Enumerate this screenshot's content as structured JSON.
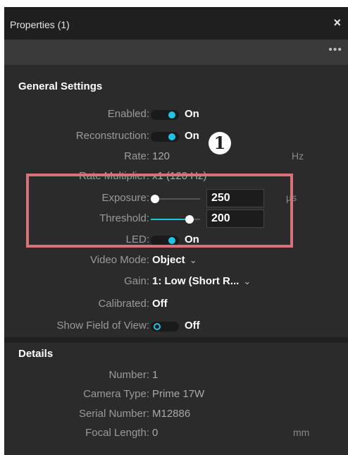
{
  "window": {
    "title": "Properties (1)",
    "close_glyph": "×",
    "more_glyph": "•••"
  },
  "general": {
    "title": "General Settings",
    "enabled": {
      "label": "Enabled:",
      "state": "On"
    },
    "reconstruction": {
      "label": "Reconstruction:",
      "state": "On"
    },
    "rate": {
      "label": "Rate:",
      "value": "120",
      "unit": "Hz"
    },
    "rate_multiplier": {
      "label": "Rate Multiplier:",
      "value": "x1 (120 Hz)"
    },
    "exposure": {
      "label": "Exposure:",
      "value": "250",
      "unit": "µs",
      "slider_fraction": 0.08
    },
    "threshold": {
      "label": "Threshold:",
      "value": "200",
      "slider_fraction": 0.78
    },
    "led": {
      "label": "LED:",
      "state": "On"
    },
    "video_mode": {
      "label": "Video Mode:",
      "value": "Object"
    },
    "gain": {
      "label": "Gain:",
      "value": "1: Low (Short R..."
    },
    "calibrated": {
      "label": "Calibrated:",
      "value": "Off"
    },
    "show_fov": {
      "label": "Show Field of View:",
      "state": "Off"
    }
  },
  "details": {
    "title": "Details",
    "number": {
      "label": "Number:",
      "value": "1"
    },
    "camera_type": {
      "label": "Camera Type:",
      "value": "Prime 17W"
    },
    "serial_number": {
      "label": "Serial Number:",
      "value": "M12886"
    },
    "focal_length": {
      "label": "Focal Length:",
      "value": "0",
      "unit": "mm"
    }
  },
  "annotation": {
    "badge": "1",
    "highlight_color": "#d5727a"
  },
  "colors": {
    "accent": "#1fc3e6",
    "panel_bg": "#2b2b2b",
    "titlebar_bg": "#1f1f1f"
  }
}
